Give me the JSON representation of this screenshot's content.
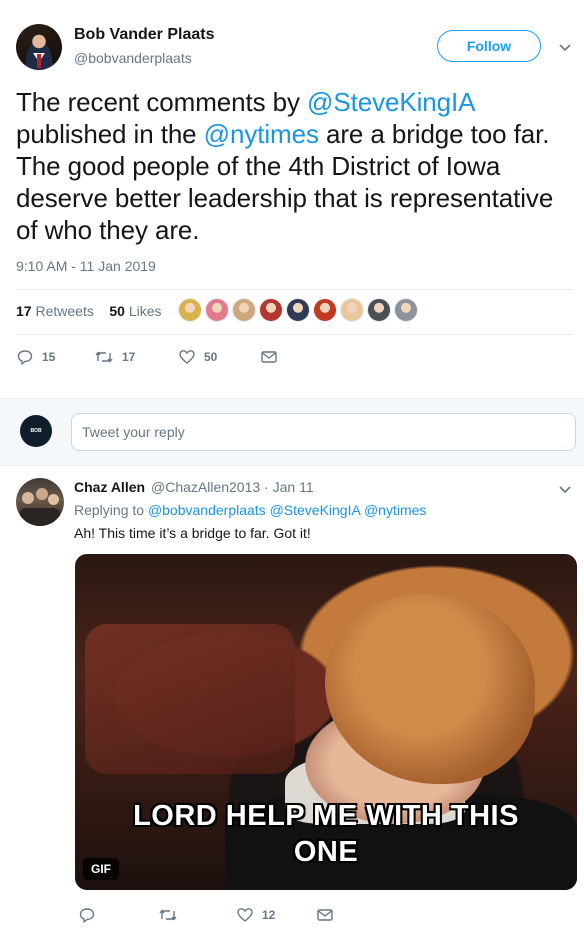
{
  "tweet": {
    "author_name": "Bob Vander Plaats",
    "author_handle": "@bobvanderplaats",
    "follow_label": "Follow",
    "text_parts": [
      "The recent comments by ",
      "@SteveKingIA",
      " published in the ",
      "@nytimes",
      " are a bridge too far. The good people of the 4th District of Iowa deserve better leadership that is representative of who they are."
    ],
    "timestamp": "9:10 AM - 11 Jan 2019",
    "retweets_count": "17",
    "retweets_label": "Retweets",
    "likes_count": "50",
    "likes_label": "Likes",
    "likers": [
      {
        "name": "liker-1",
        "color": "#d9b34a"
      },
      {
        "name": "liker-2",
        "color": "#e07a8c"
      },
      {
        "name": "liker-3",
        "color": "#cfa77e"
      },
      {
        "name": "liker-4",
        "color": "#b2362f"
      },
      {
        "name": "liker-5",
        "color": "#2e3a56"
      },
      {
        "name": "liker-6",
        "color": "#c23a22"
      },
      {
        "name": "liker-7",
        "color": "#e8c59a"
      },
      {
        "name": "liker-8",
        "color": "#4a4e57"
      },
      {
        "name": "liker-9",
        "color": "#8e939a"
      }
    ],
    "actions": {
      "reply_count": "15",
      "retweet_count": "17",
      "like_count": "50"
    }
  },
  "reply_box": {
    "placeholder": "Tweet your reply",
    "avatar_text": "BOB"
  },
  "reply": {
    "author_name": "Chaz Allen",
    "author_handle_date": "@ChazAllen2013 · Jan 11",
    "replying_prefix": "Replying to ",
    "replying_to": "@bobvanderplaats @SteveKingIA @nytimes",
    "text": "Ah! This time it’s a bridge to far. Got it!",
    "gif_caption_line1": "LORD HELP ME WITH THIS",
    "gif_caption_line2": "ONE",
    "gif_badge": "GIF",
    "actions": {
      "reply_count": "",
      "retweet_count": "",
      "like_count": "12"
    }
  },
  "colors": {
    "accent": "#1da1f2",
    "link": "#1b95e0",
    "muted": "#657786"
  }
}
